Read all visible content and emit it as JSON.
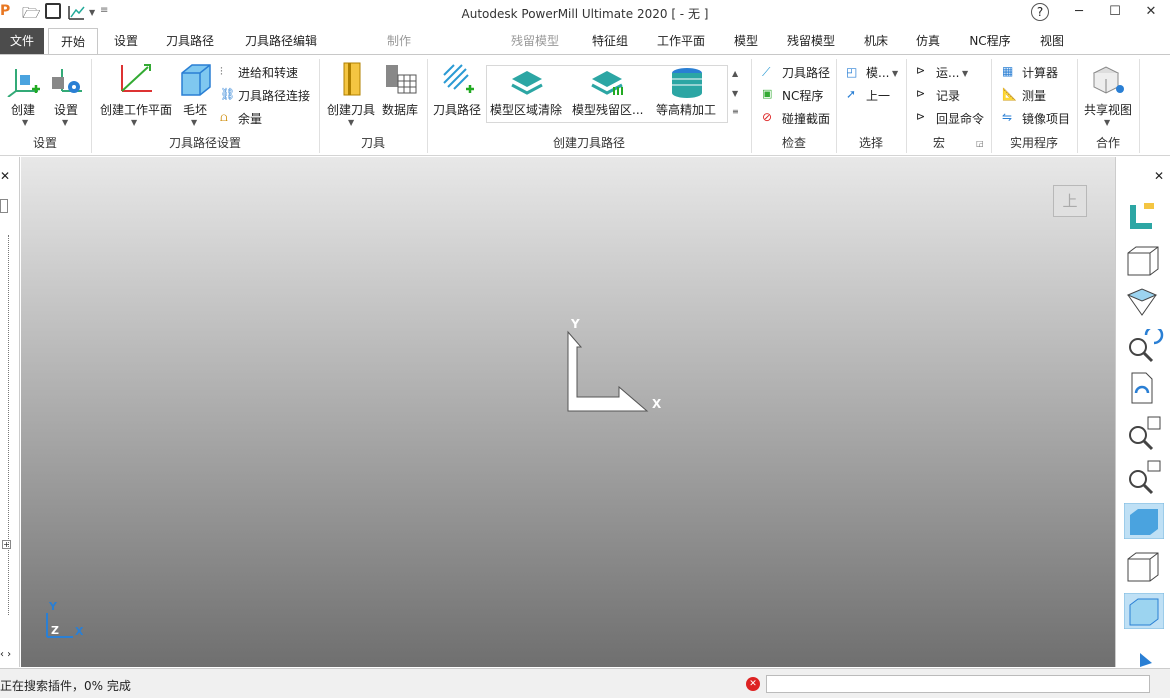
{
  "title": "Autodesk PowerMill Ultimate 2020 [ - 无 ]",
  "window": {
    "help": "?",
    "minimize": "─",
    "maximize": "☐",
    "close": "✕"
  },
  "tabs": [
    "文件",
    "开始",
    "设置",
    "刀具路径",
    "刀具路径编辑",
    "制作",
    "残留模型",
    "特征组",
    "工作平面",
    "模型",
    "残留模型",
    "机床",
    "仿真",
    "NC程序",
    "视图"
  ],
  "groups": {
    "setup": {
      "label": "设置",
      "buttons": [
        "创建",
        "设置"
      ]
    },
    "toolpath_setup": {
      "label": "刀具路径设置",
      "create_wp": "创建工作平面",
      "block": "毛坯",
      "feeds": "进给和转速",
      "links": "刀具路径连接",
      "thickness": "余量"
    },
    "tool": {
      "label": "刀具",
      "create_tool": "创建刀具",
      "database": "数据库"
    },
    "create_toolpath": {
      "label": "创建刀具路径",
      "toolpath": "刀具路径",
      "gallery": [
        "模型区域清除",
        "模型残留区...",
        "等高精加工"
      ]
    },
    "check": {
      "label": "检查",
      "items": [
        "刀具路径",
        "NC程序",
        "碰撞截面"
      ]
    },
    "select": {
      "label": "选择",
      "items": [
        "模...",
        "上一"
      ]
    },
    "macro": {
      "label": "宏",
      "items": [
        "运...",
        "记录",
        "回显命令"
      ]
    },
    "utilities": {
      "label": "实用程序",
      "items": [
        "计算器",
        "测量",
        "镜像项目"
      ]
    },
    "collab": {
      "label": "合作",
      "share": "共享视图"
    }
  },
  "viewport": {
    "view_label": "上",
    "axis_y": "Y",
    "axis_x": "X",
    "mini_y": "Y",
    "mini_z": "Z",
    "mini_x": "X"
  },
  "status": {
    "text": "正在搜索插件，0% 完成"
  },
  "colors": {
    "accent": "#2ca6a4",
    "file_tab": "#4c4c4c"
  }
}
